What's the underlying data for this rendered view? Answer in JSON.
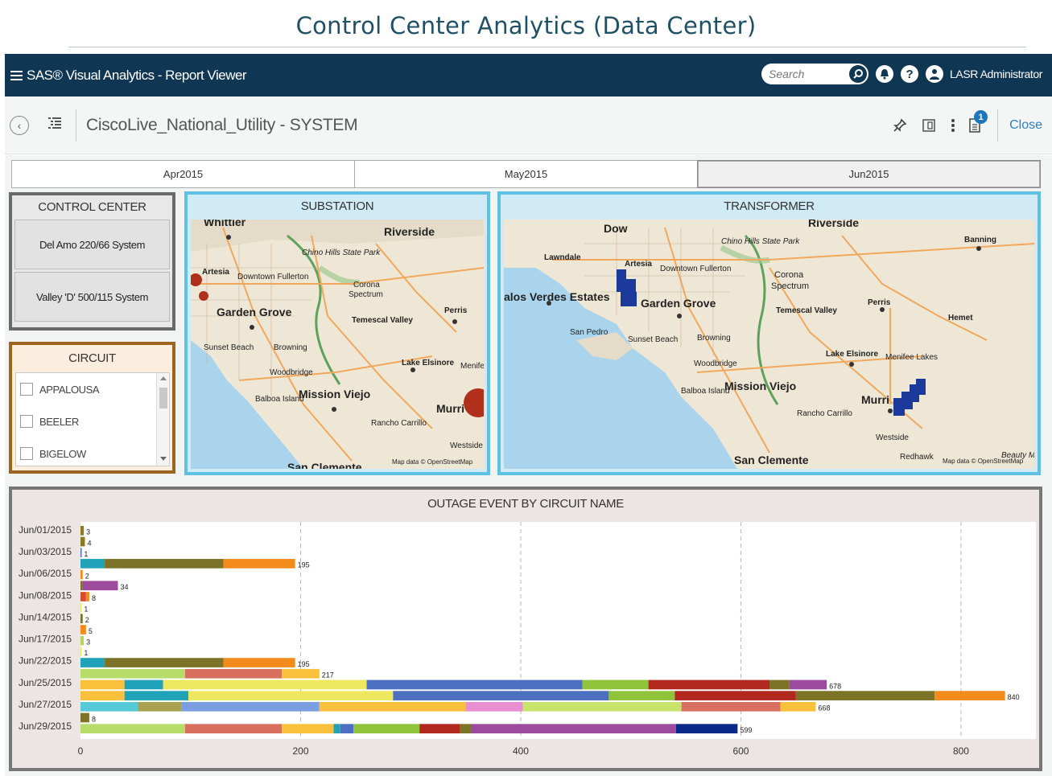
{
  "caption": "Control Center Analytics (Data Center)",
  "app_bar": {
    "title": "SAS® Visual Analytics - Report Viewer",
    "search_placeholder": "Search",
    "user": "LASR Administrator"
  },
  "toolbar": {
    "report_title": "CiscoLive_National_Utility - SYSTEM",
    "notification_count": "1",
    "close_label": "Close"
  },
  "month_tabs": [
    {
      "label": "Apr2015",
      "active": false
    },
    {
      "label": "May2015",
      "active": false
    },
    {
      "label": "Jun2015",
      "active": true
    }
  ],
  "control_center": {
    "title": "CONTROL CENTER",
    "items": [
      "Del Amo 220/66 System",
      "Valley 'D' 500/115 System"
    ]
  },
  "circuit": {
    "title": "CIRCUIT",
    "items": [
      "APPALOUSA",
      "BEELER",
      "BIGELOW"
    ]
  },
  "substation_map": {
    "title": "SUBSTATION",
    "labels": [
      "Whittier",
      "Riverside",
      "Chino Hills State Park",
      "Artesia",
      "Downtown Fullerton",
      "Corona",
      "Spectrum",
      "Garden Grove",
      "Perris",
      "Temescal Valley",
      "Sunset Beach",
      "Browning",
      "Lake Elsinore",
      "Menife Lakes",
      "Woodbridge",
      "Mission Viejo",
      "Balboa Island",
      "Murri",
      "Rancho Carrillo",
      "Westside",
      "San Clemente"
    ],
    "attribution": "Map data © OpenStreetMap"
  },
  "transformer_map": {
    "title": "TRANSFORMER",
    "labels": [
      "Dow",
      "Riverside",
      "Banning",
      "Chino Hills State Park",
      "Lawndale",
      "Artesia",
      "Downtown Fullerton",
      "Corona",
      "Spectrum",
      "alos Verdes Estates",
      "Garden Grove",
      "Perris",
      "San Pedro",
      "Temescal Valley",
      "Hemet",
      "Sunset Beach",
      "Browning",
      "Lake Elsinore",
      "Menifee Lakes",
      "Woodbridge",
      "Mission Viejo",
      "Balboa Island",
      "Murri",
      "Rancho Carrillo",
      "Westside",
      "San Clemente",
      "Redhawk",
      "Beauty Mountain"
    ],
    "attribution": "Map data © OpenStreetMap"
  },
  "chart_data": {
    "type": "bar",
    "orientation": "horizontal",
    "stacked": true,
    "title": "OUTAGE EVENT BY CIRCUIT NAME",
    "xlim": [
      0,
      860
    ],
    "x_ticks": [
      0,
      200,
      400,
      600,
      800
    ],
    "y_tick_labels": [
      "Jun/01/2015",
      "Jun/03/2015",
      "Jun/06/2015",
      "Jun/08/2015",
      "Jun/14/2015",
      "Jun/17/2015",
      "Jun/22/2015",
      "Jun/25/2015",
      "Jun/27/2015",
      "Jun/29/2015"
    ],
    "bars": [
      {
        "total": "3",
        "segments": [
          {
            "v": 3,
            "c": "#8a7a22"
          }
        ]
      },
      {
        "total": "4",
        "segments": [
          {
            "v": 4,
            "c": "#8a7a22"
          }
        ]
      },
      {
        "total": "1",
        "segments": [
          {
            "v": 1,
            "c": "#4d6fbf"
          }
        ]
      },
      {
        "total": "195",
        "segments": [
          {
            "v": 22,
            "c": "#20a3b8"
          },
          {
            "v": 108,
            "c": "#7d7326"
          },
          {
            "v": 65,
            "c": "#f28a1c"
          }
        ]
      },
      {
        "total": "2",
        "segments": [
          {
            "v": 2,
            "c": "#f28a1c"
          }
        ]
      },
      {
        "total": "34",
        "segments": [
          {
            "v": 2,
            "c": "#7d7326"
          },
          {
            "v": 32,
            "c": "#9b4a9d"
          }
        ]
      },
      {
        "total": "8",
        "segments": [
          {
            "v": 5,
            "c": "#d64b2a"
          },
          {
            "v": 3,
            "c": "#f28a1c"
          }
        ]
      },
      {
        "total": "1",
        "segments": [
          {
            "v": 1,
            "c": "#ede85e"
          }
        ]
      },
      {
        "total": "2",
        "segments": [
          {
            "v": 2,
            "c": "#7d7326"
          }
        ]
      },
      {
        "total": "5",
        "segments": [
          {
            "v": 5,
            "c": "#f28a1c"
          }
        ]
      },
      {
        "total": "3",
        "segments": [
          {
            "v": 3,
            "c": "#b5d65a"
          }
        ]
      },
      {
        "total": "1",
        "segments": [
          {
            "v": 1,
            "c": "#ede85e"
          }
        ]
      },
      {
        "total": "195",
        "segments": [
          {
            "v": 22,
            "c": "#20a3b8"
          },
          {
            "v": 108,
            "c": "#7d7326"
          },
          {
            "v": 65,
            "c": "#f28a1c"
          }
        ]
      },
      {
        "total": "217",
        "segments": [
          {
            "v": 95,
            "c": "#b6dc6a"
          },
          {
            "v": 88,
            "c": "#d9705f"
          },
          {
            "v": 34,
            "c": "#f8c03b"
          }
        ]
      },
      {
        "total": "678",
        "segments": [
          {
            "v": 40,
            "c": "#f8c03b"
          },
          {
            "v": 35,
            "c": "#20a3b8"
          },
          {
            "v": 185,
            "c": "#ede85e"
          },
          {
            "v": 196,
            "c": "#4d6fbf"
          },
          {
            "v": 60,
            "c": "#8fc43a"
          },
          {
            "v": 110,
            "c": "#b3281e"
          },
          {
            "v": 18,
            "c": "#7d7326"
          },
          {
            "v": 34,
            "c": "#9b4a9d"
          }
        ]
      },
      {
        "total": "840",
        "segments": [
          {
            "v": 40,
            "c": "#f8c03b"
          },
          {
            "v": 58,
            "c": "#20a3b8"
          },
          {
            "v": 186,
            "c": "#ede85e"
          },
          {
            "v": 196,
            "c": "#4d6fbf"
          },
          {
            "v": 60,
            "c": "#8fc43a"
          },
          {
            "v": 110,
            "c": "#b3281e"
          },
          {
            "v": 126,
            "c": "#7d7326"
          },
          {
            "v": 64,
            "c": "#f28a1c"
          }
        ]
      },
      {
        "total": "668",
        "segments": [
          {
            "v": 52,
            "c": "#55c9d8"
          },
          {
            "v": 40,
            "c": "#a9a050"
          },
          {
            "v": 125,
            "c": "#7b9ee0"
          },
          {
            "v": 133,
            "c": "#f8c03b"
          },
          {
            "v": 52,
            "c": "#e98ed0"
          },
          {
            "v": 144,
            "c": "#c8e36b"
          },
          {
            "v": 90,
            "c": "#d9705f"
          },
          {
            "v": 32,
            "c": "#f8c03b"
          }
        ]
      },
      {
        "total": "8",
        "segments": [
          {
            "v": 8,
            "c": "#7d7326"
          }
        ]
      },
      {
        "total": "599",
        "segments": [
          {
            "v": 95,
            "c": "#b6dc6a"
          },
          {
            "v": 88,
            "c": "#d9705f"
          },
          {
            "v": 47,
            "c": "#f8c03b"
          },
          {
            "v": 6,
            "c": "#20a3b8"
          },
          {
            "v": 12,
            "c": "#4d6fbf"
          },
          {
            "v": 60,
            "c": "#8fc43a"
          },
          {
            "v": 37,
            "c": "#b3281e"
          },
          {
            "v": 10,
            "c": "#7d7326"
          },
          {
            "v": 186,
            "c": "#9b4a9d"
          },
          {
            "v": 56,
            "c": "#0a2a8a"
          }
        ]
      }
    ]
  }
}
